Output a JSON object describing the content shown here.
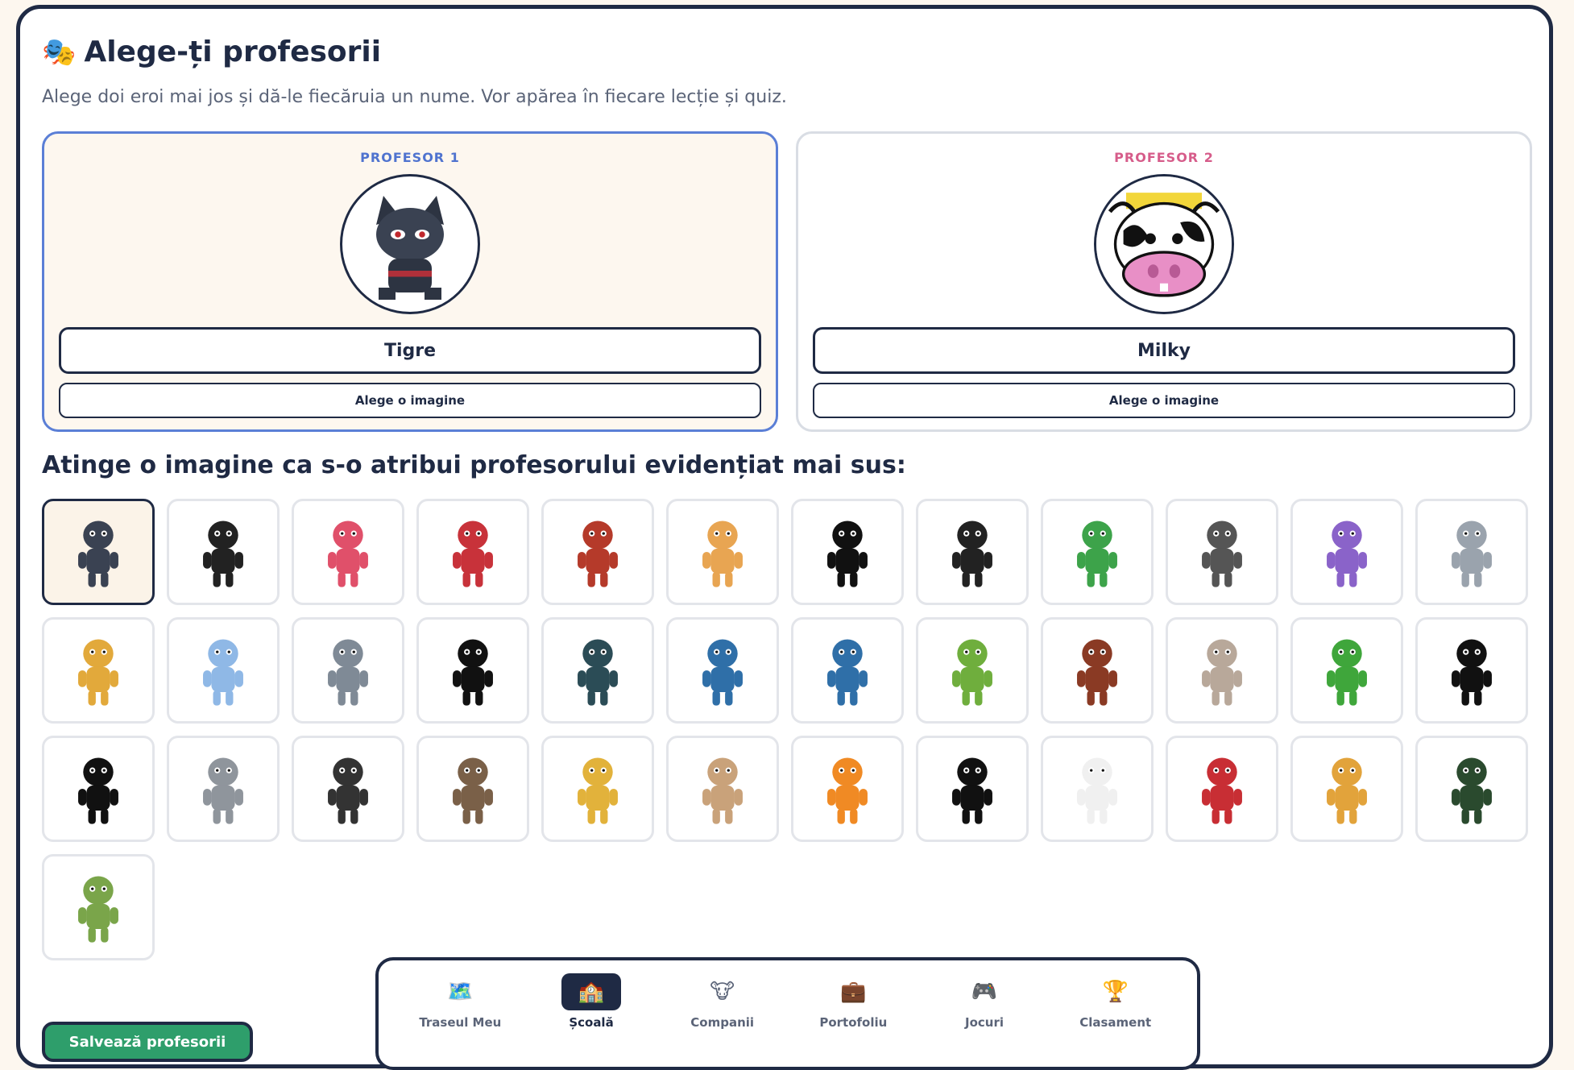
{
  "header": {
    "emoji": "🎭",
    "title": "Alege-ți profesorii",
    "subtitle": "Alege doi eroi mai jos și dă-le fiecăruia un nume. Vor apărea în fiecare lecție și quiz."
  },
  "teachers": [
    {
      "label": "PROFESOR 1",
      "name": "Tigre",
      "button": "Alege o imagine",
      "avatar": "ninja-cat",
      "selected": true
    },
    {
      "label": "PROFESOR 2",
      "name": "Milky",
      "button": "Alege o imagine",
      "avatar": "cow",
      "selected": false
    }
  ],
  "grid": {
    "title": "Atinge o imagine ca s-o atribui profesorului evidențiat mai sus:",
    "characters": [
      "ninja-cat",
      "gorilla-gunman",
      "pink-blob-monster",
      "bear-footballer",
      "bull-footballer",
      "owl-professor",
      "cow",
      "dark-helmet-knight",
      "green-dinosaur",
      "gorilla-rose",
      "purple-dragon",
      "penguin-shark-hood",
      "dog-footballer",
      "blue-elephant",
      "elephant-footballer",
      "mouse-silhouette",
      "fish",
      "blue-whale-monster",
      "angler-fish",
      "frog",
      "basketball-gorilla",
      "yeti",
      "green-monster",
      "pirate-penguin",
      "grim-reaper",
      "rhino",
      "skeleton",
      "sloth",
      "sloth-footballer",
      "karate-sloth",
      "orange-dj",
      "weightlifter",
      "sombrero-dog",
      "pug-footballer",
      "lion-footballer",
      "eagle-footballer",
      "zombie"
    ]
  },
  "nav": {
    "items": [
      {
        "label": "Traseul Meu",
        "icon": "🗺️",
        "active": false
      },
      {
        "label": "Școală",
        "icon": "🏫",
        "active": true
      },
      {
        "label": "Companii",
        "icon": "🐮",
        "active": false
      },
      {
        "label": "Portofoliu",
        "icon": "💼",
        "active": false
      },
      {
        "label": "Jocuri",
        "icon": "🎮",
        "active": false
      },
      {
        "label": "Clasament",
        "icon": "🏆",
        "active": false
      }
    ]
  },
  "save_button": "Salvează profesorii",
  "colors": {
    "accent_blue": "#5b7fd6",
    "accent_pink": "#d65c8a",
    "navy": "#1f2a44",
    "green": "#2e9e6b"
  }
}
